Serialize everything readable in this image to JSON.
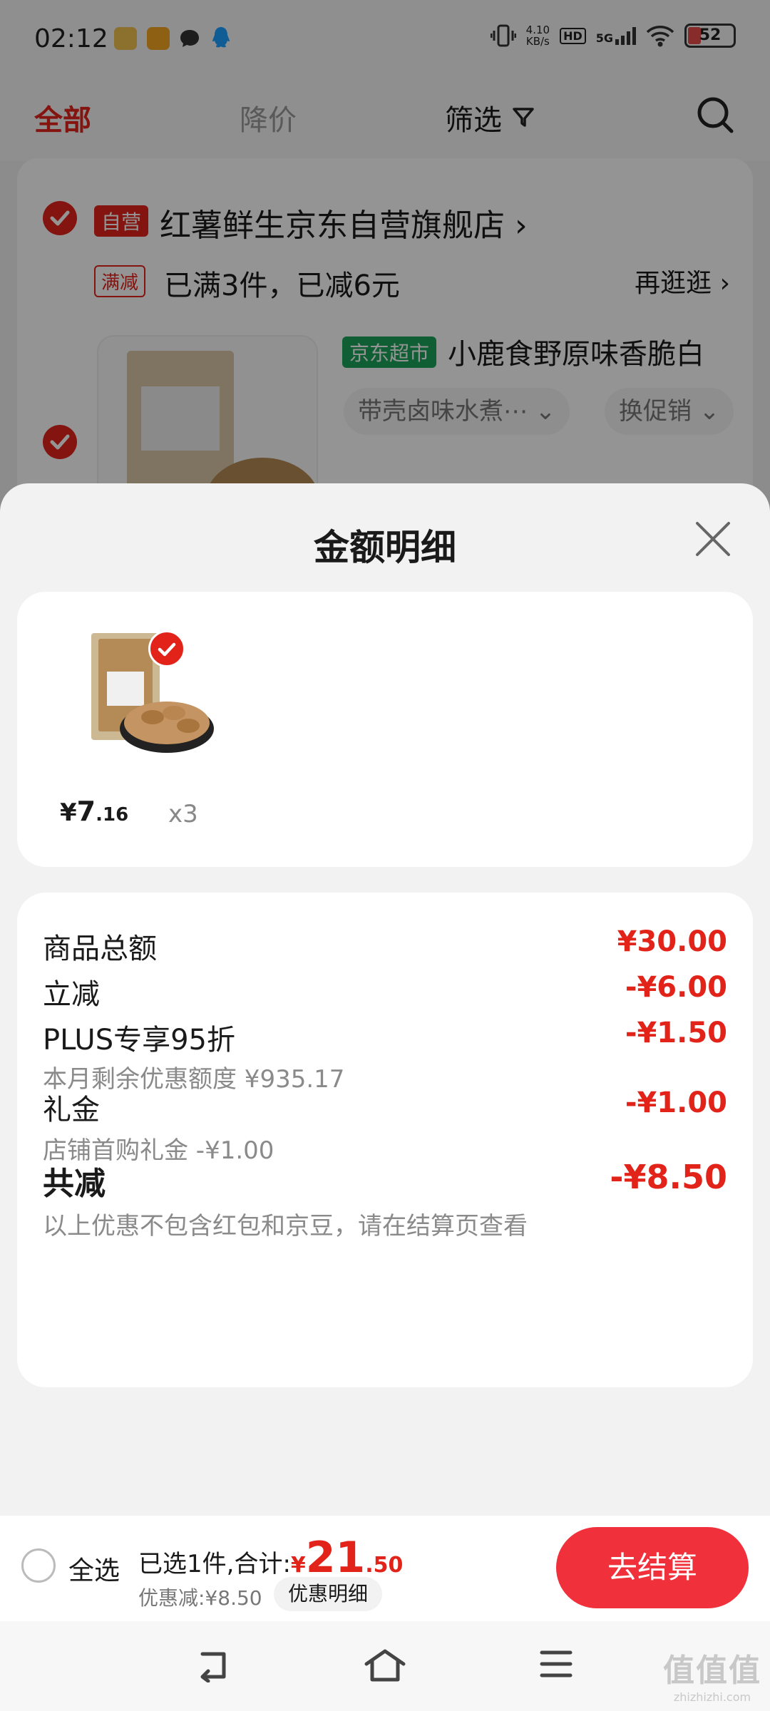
{
  "status_bar": {
    "time": "02:12",
    "net_speed_value": "4.10",
    "net_speed_unit": "KB/s",
    "hd": "HD",
    "signal": "5G",
    "battery": "52",
    "icons": [
      "app-notification-icon",
      "app-notification-icon",
      "message-icon",
      "qq-icon",
      "vibrate-icon",
      "wifi-icon"
    ]
  },
  "cart": {
    "tabs": {
      "all": "全部",
      "price_drop": "降价",
      "filter": "筛选"
    },
    "store": {
      "self_badge": "自营",
      "name": "红薯鲜生京东自营旗舰店 ›",
      "promo_badge": "满减",
      "promo_text": "已满3件，已减6元",
      "promo_link": "再逛逛 ›"
    },
    "product": {
      "badge": "京东超市",
      "name": "小鹿食野原味香脆白",
      "spec_chip": "带壳卤味水煮⋯ ⌄",
      "promo_chip": "换促销 ⌄"
    }
  },
  "sheet": {
    "title": "金额明细",
    "item": {
      "yen": "¥",
      "price_int": "7",
      "price_dec": ".16",
      "qty": "x3"
    },
    "rows": {
      "subtotal_label": "商品总额",
      "subtotal_value": "¥30.00",
      "instant_label": "立减",
      "instant_value": "-¥6.00",
      "plus_label": "PLUS专享95折",
      "plus_sub": "本月剩余优惠额度 ¥935.17",
      "plus_value": "-¥1.50",
      "gift_label": "礼金",
      "gift_sub": "店铺首购礼金 -¥1.00",
      "gift_value": "-¥1.00",
      "total_label": "共减",
      "total_value": "-¥8.50",
      "note": "以上优惠不包含红包和京豆，请在结算页查看"
    }
  },
  "bottom_bar": {
    "select_all": "全选",
    "summary_prefix": "已选1件,合计:",
    "yen": "¥",
    "total_int": "21",
    "total_dec": ".50",
    "discount": "优惠减:¥8.50",
    "discount_detail_btn": "优惠明细",
    "checkout": "去结算"
  },
  "watermark": {
    "big": "值值值",
    "small": "zhizhizhi.com"
  },
  "colors": {
    "accent": "#e2231a",
    "checkout": "#f0303a",
    "supermarket": "#1aa35a"
  }
}
